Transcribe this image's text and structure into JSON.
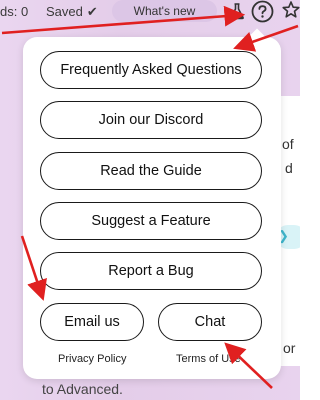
{
  "topbar": {
    "partial_label": "ds: 0",
    "saved_label": "Saved",
    "saved_check": "✔",
    "whats_new_label": "What's new"
  },
  "menu": {
    "faq_label": "Frequently Asked Questions",
    "discord_label": "Join our Discord",
    "guide_label": "Read the Guide",
    "suggest_label": "Suggest a Feature",
    "bug_label": "Report a Bug",
    "email_label": "Email us",
    "chat_label": "Chat",
    "privacy_label": "Privacy Policy",
    "terms_label": "Terms of Use"
  },
  "background": {
    "text_of": "of",
    "text_d": "d",
    "text_or": "or",
    "bottom_text": "to Advanced."
  },
  "icons": {
    "flask": "flask-icon",
    "help": "help-circle-icon",
    "star": "star-icon",
    "check": "check-icon"
  },
  "colors": {
    "background": "#e8d3ee",
    "pill": "#dcc6e6",
    "annotation": "#e02020",
    "button_border": "#1a1a1a"
  }
}
